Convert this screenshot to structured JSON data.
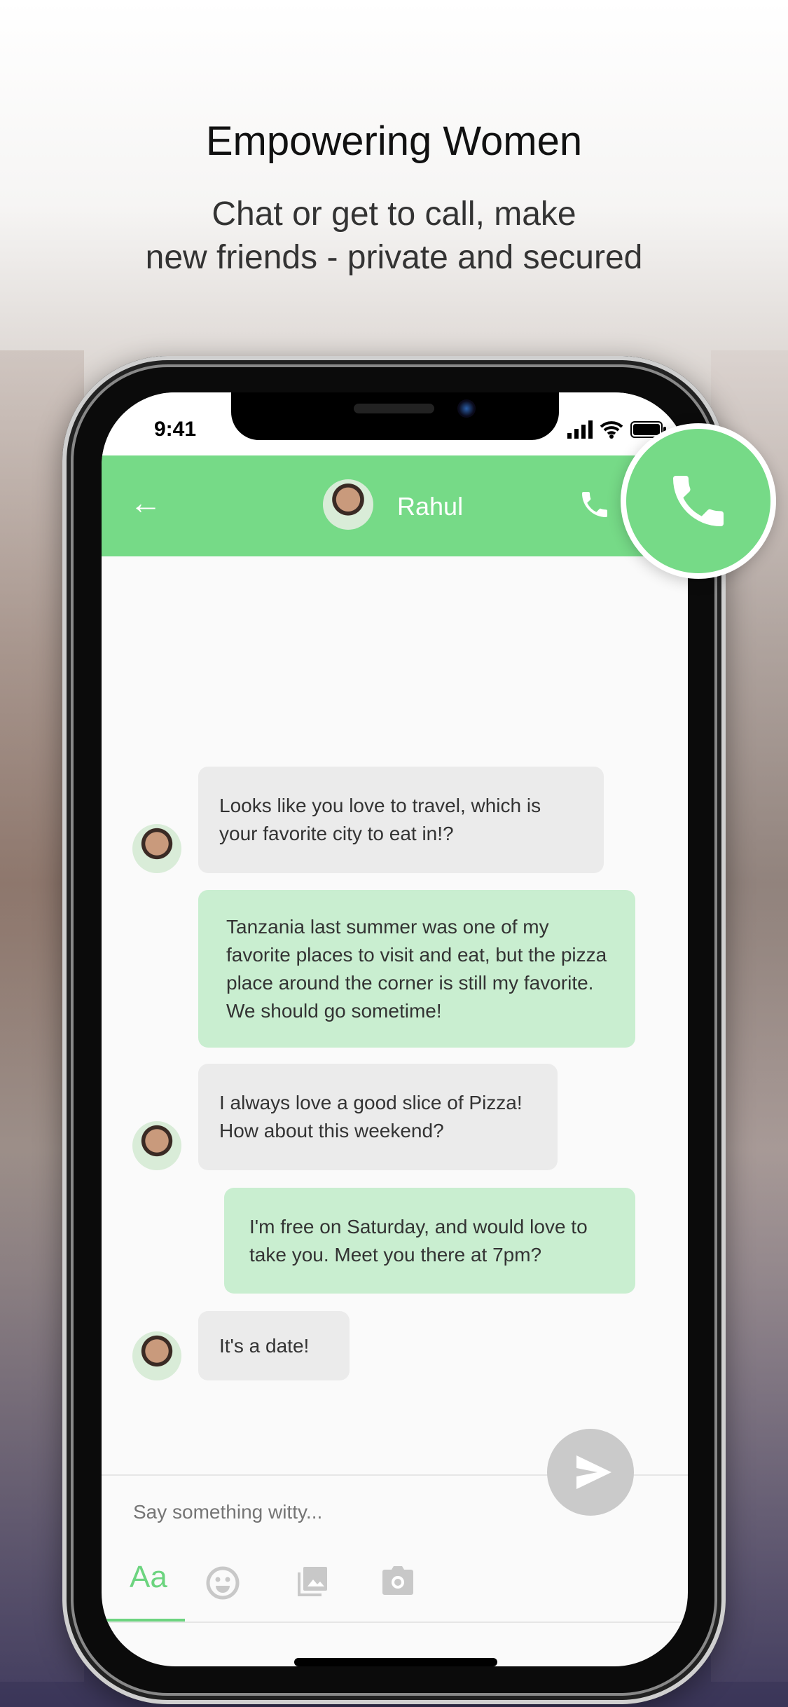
{
  "promo": {
    "headline": "Empowering Women",
    "subtitle_line1": "Chat or get to call, make",
    "subtitle_line2": "new friends - private and secured"
  },
  "status_bar": {
    "time": "9:41"
  },
  "header": {
    "contact_name": "Rahul",
    "back_icon": "arrow-left-icon",
    "call_icon": "phone-icon"
  },
  "messages": [
    {
      "direction": "incoming",
      "text": "Looks like you love to travel, which is your favorite city to eat in!?"
    },
    {
      "direction": "outgoing",
      "text": "Tanzania last summer was one of my favorite places to visit and eat, but the pizza place around the corner is still my favorite. We should go sometime!"
    },
    {
      "direction": "incoming",
      "text": "I always love a good slice of Pizza! How about this weekend?"
    },
    {
      "direction": "outgoing",
      "text": "I'm free on Saturday, and would love to take you. Meet you there at 7pm?"
    },
    {
      "direction": "incoming",
      "text": "It's a date!"
    }
  ],
  "composer": {
    "placeholder": "Say something witty...",
    "text_tab_label": "Aa",
    "tabs": [
      "text",
      "emoji-icon",
      "gallery-icon",
      "camera-icon"
    ],
    "active_tab": "text"
  },
  "colors": {
    "accent": "#76da87",
    "incoming_bubble": "#ebebeb",
    "outgoing_bubble": "#c9eed0",
    "send_button": "#cacaca"
  }
}
